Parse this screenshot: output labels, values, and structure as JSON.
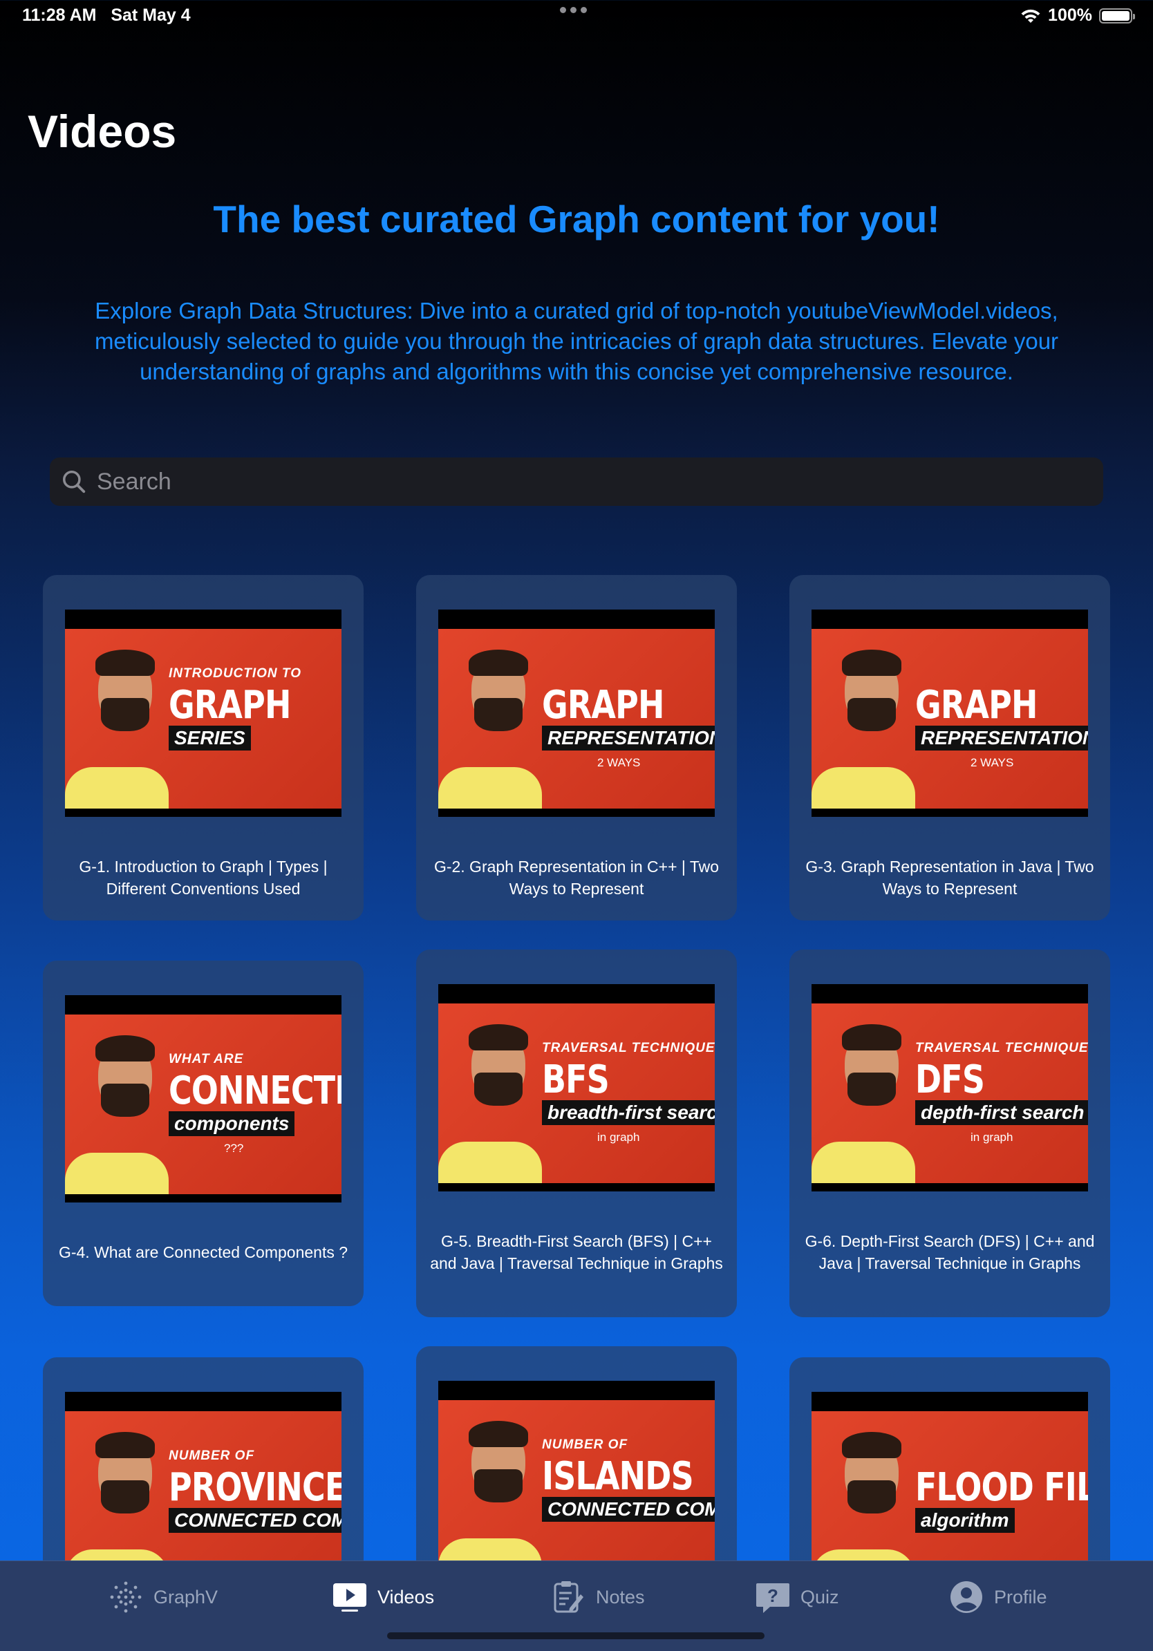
{
  "status": {
    "time": "11:28 AM",
    "date": "Sat May 4",
    "battery": "100%"
  },
  "page_title": "Videos",
  "tagline": "The best curated Graph content for you!",
  "description": "Explore Graph Data Structures: Dive into a curated grid of top-notch youtubeViewModel.videos, meticulously selected to guide you through the intricacies of graph data structures. Elevate your understanding of graphs and algorithms with this concise yet comprehensive resource.",
  "search": {
    "placeholder": "Search",
    "value": ""
  },
  "videos": [
    {
      "title": "G-1. Introduction to Graph | Types | Different Conventions Used",
      "thumb_line1": "INTRODUCTION TO",
      "thumb_line2": "GRAPH",
      "thumb_line3": "SERIES",
      "thumb_line4": ""
    },
    {
      "title": "G-2. Graph Representation in C++ | Two Ways to Represent",
      "thumb_line1": "",
      "thumb_line2": "GRAPH",
      "thumb_line3": "REPRESENTATION in C++",
      "thumb_line4": "2 WAYS"
    },
    {
      "title": "G-3. Graph Representation in Java | Two Ways to Represent",
      "thumb_line1": "",
      "thumb_line2": "GRAPH",
      "thumb_line3": "REPRESENTATION in Java",
      "thumb_line4": "2 WAYS"
    },
    {
      "title": "G-4. What are Connected Components ?",
      "thumb_line1": "WHAT ARE",
      "thumb_line2": "CONNECTED",
      "thumb_line3": "components",
      "thumb_line4": "???"
    },
    {
      "title": "G-5. Breadth-First Search (BFS) | C++ and Java | Traversal Technique in Graphs",
      "thumb_line1": "TRAVERSAL TECHNIQUES",
      "thumb_line2": "BFS",
      "thumb_line3": "breadth-first search",
      "thumb_line4": "in graph"
    },
    {
      "title": "G-6. Depth-First Search (DFS) | C++ and Java | Traversal Technique in Graphs",
      "thumb_line1": "TRAVERSAL TECHNIQUES",
      "thumb_line2": "DFS",
      "thumb_line3": "depth-first search",
      "thumb_line4": "in graph"
    },
    {
      "title": "",
      "thumb_line1": "NUMBER OF",
      "thumb_line2": "PROVINCES",
      "thumb_line3": "CONNECTED COMPONENTS",
      "thumb_line4": ""
    },
    {
      "title": "",
      "thumb_line1": "NUMBER OF",
      "thumb_line2": "ISLANDS",
      "thumb_line3": "CONNECTED COMPONENTS",
      "thumb_line4": ""
    },
    {
      "title": "",
      "thumb_line1": "",
      "thumb_line2": "FLOOD FILL",
      "thumb_line3": "algorithm",
      "thumb_line4": ""
    }
  ],
  "tabs": [
    {
      "label": "GraphV",
      "icon": "graph-dots-icon",
      "active": false
    },
    {
      "label": "Videos",
      "icon": "play-icon",
      "active": true
    },
    {
      "label": "Notes",
      "icon": "notes-icon",
      "active": false
    },
    {
      "label": "Quiz",
      "icon": "question-icon",
      "active": false
    },
    {
      "label": "Profile",
      "icon": "person-icon",
      "active": false
    }
  ],
  "colors": {
    "accent": "#1a8cff",
    "tab_active": "#ffffff",
    "tab_inactive": "#9aa6bd"
  }
}
